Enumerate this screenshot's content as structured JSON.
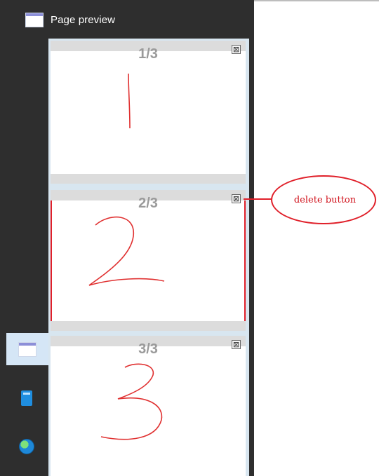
{
  "panel": {
    "title": "Page preview"
  },
  "thumbnails": [
    {
      "page_label": "1/3",
      "close_symbol": "⊠",
      "drawing": "1",
      "selected": false
    },
    {
      "page_label": "2/3",
      "close_symbol": "⊠",
      "drawing": "2",
      "selected": true
    },
    {
      "page_label": "3/3",
      "close_symbol": "⊠",
      "drawing": "3",
      "selected": false
    }
  ],
  "rail": {
    "items": [
      {
        "icon": "page-preview-icon",
        "active": true
      },
      {
        "icon": "book-icon",
        "active": false
      },
      {
        "icon": "globe-icon",
        "active": false
      }
    ]
  },
  "annotation": {
    "text": "delete button",
    "color": "#e0202a"
  }
}
